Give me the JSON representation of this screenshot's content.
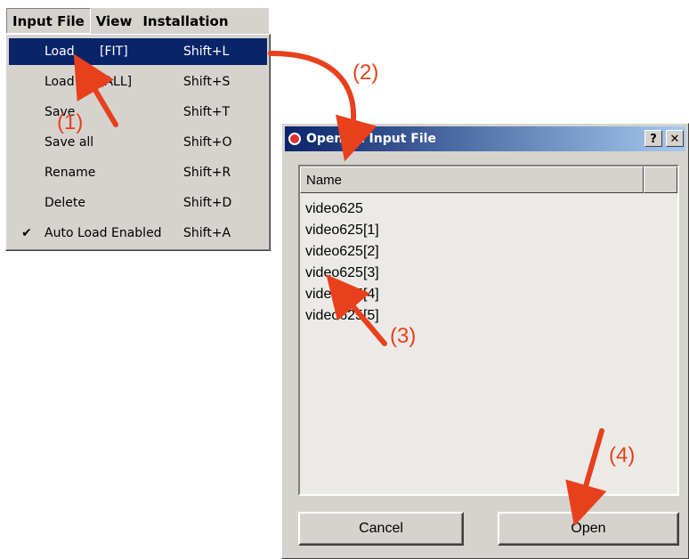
{
  "menubar": {
    "items": [
      "Input File",
      "View",
      "Installation"
    ]
  },
  "dropdown": {
    "items": [
      {
        "label": "Load",
        "arg": "[FIT]",
        "shortcut": "Shift+L",
        "checked": "",
        "highlighted": true
      },
      {
        "label": "Load",
        "arg": "[ALL]",
        "shortcut": "Shift+S",
        "checked": ""
      },
      {
        "label": "Save",
        "arg": "",
        "shortcut": "Shift+T",
        "checked": ""
      },
      {
        "label": "Save all",
        "arg": "",
        "shortcut": "Shift+O",
        "checked": ""
      },
      {
        "label": "Rename",
        "arg": "",
        "shortcut": "Shift+R",
        "checked": ""
      },
      {
        "label": "Delete",
        "arg": "",
        "shortcut": "Shift+D",
        "checked": ""
      },
      {
        "label": "Auto Load Enabled",
        "arg": "",
        "shortcut": "Shift+A",
        "checked": "✔"
      }
    ]
  },
  "dialog": {
    "title": "Open an Input File",
    "help_label": "?",
    "close_label": "✕",
    "column_header": "Name",
    "files": [
      "video625",
      "video625[1]",
      "video625[2]",
      "video625[3]",
      "video625[4]",
      "video625[5]"
    ],
    "cancel_label": "Cancel",
    "open_label": "Open"
  },
  "annotations": {
    "step1": "(1)",
    "step2": "(2)",
    "step3": "(3)",
    "step4": "(4)",
    "color": "#e8401c"
  }
}
